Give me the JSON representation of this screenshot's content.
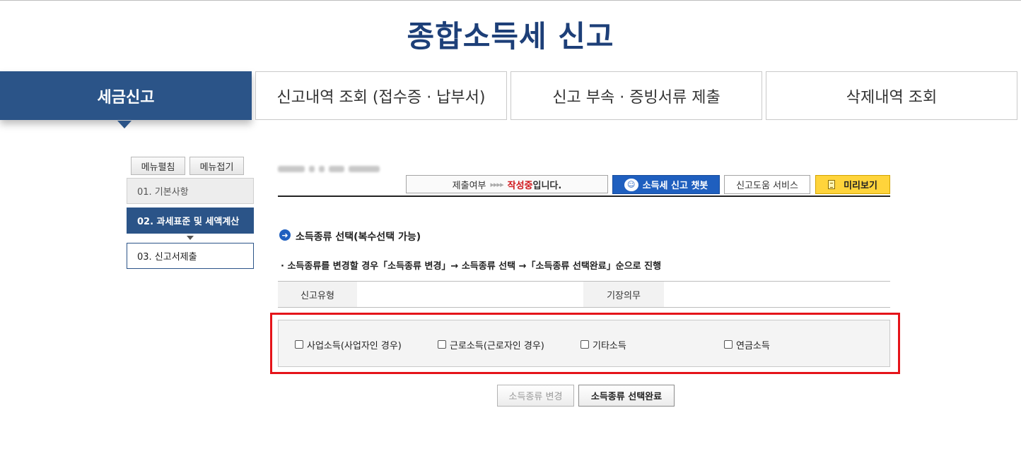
{
  "page_title": "종합소득세 신고",
  "tabs": [
    {
      "label": "세금신고",
      "active": true
    },
    {
      "label": "신고내역 조회 (접수증 · 납부서)",
      "active": false
    },
    {
      "label": "신고 부속 · 증빙서류 제출",
      "active": false
    },
    {
      "label": "삭제내역 조회",
      "active": false
    }
  ],
  "sidebar": {
    "expand_label": "메뉴펼침",
    "collapse_label": "메뉴접기",
    "steps": [
      {
        "label": "01. 기본사항",
        "state": "done"
      },
      {
        "label": "02. 과세표준 및 세액계산",
        "state": "current"
      },
      {
        "label": "03. 신고서제출",
        "state": "next"
      }
    ]
  },
  "status": {
    "label": "제출여부",
    "arrows": "▸▸▸▸",
    "state_red": "작성중",
    "state_suffix": "입니다."
  },
  "toolbar": {
    "chatbot_label": "소득세 신고 챗봇",
    "help_label": "신고도움 서비스",
    "preview_label": "미리보기"
  },
  "section": {
    "title": "소득종류 선택(복수선택 가능)",
    "guide": "· 소득종류를 변경할 경우「소득종류 변경」→ 소득종류 선택 →「소득종류 선택완료」순으로 진행"
  },
  "info_table": {
    "filing_type_label": "신고유형",
    "filing_type_value": "",
    "bookkeeping_label": "기장의무",
    "bookkeeping_value": ""
  },
  "income_types": [
    {
      "label": "사업소득(사업자인 경우)",
      "checked": false
    },
    {
      "label": "근로소득(근로자인 경우)",
      "checked": false
    },
    {
      "label": "기타소득",
      "checked": false
    },
    {
      "label": "연금소득",
      "checked": false
    }
  ],
  "buttons": {
    "change_label": "소득종류 변경",
    "complete_label": "소득종류 선택완료"
  },
  "colors": {
    "brand_navy": "#2b5488",
    "title_navy": "#1d3f78",
    "chatbot_blue": "#1f5fbf",
    "highlight_red": "#e5141a",
    "preview_yellow": "#ffd43b",
    "status_red": "#d0161b"
  }
}
